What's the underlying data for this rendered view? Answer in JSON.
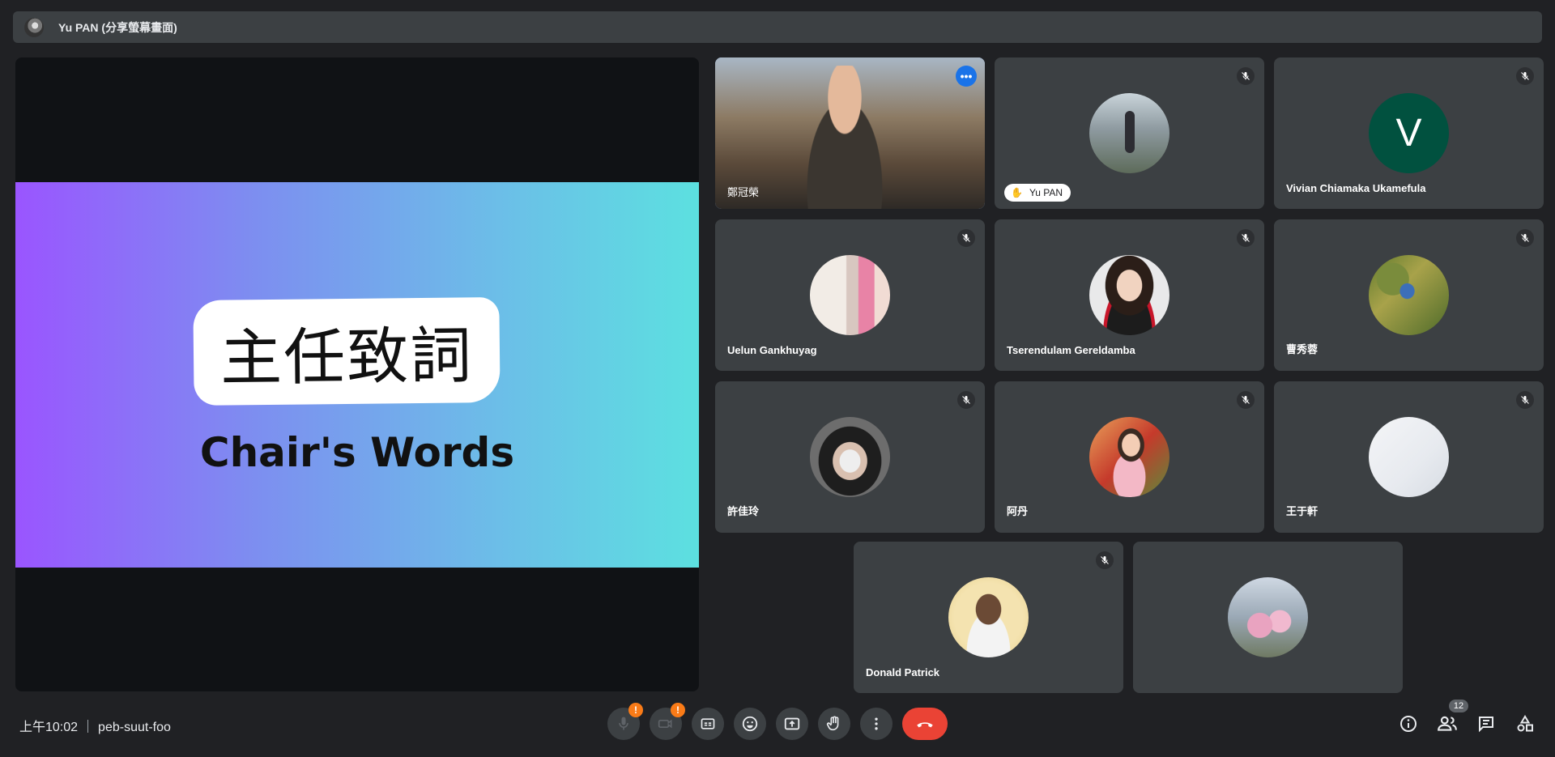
{
  "topbar": {
    "presenter_label": "Yu PAN (分享螢幕畫面)"
  },
  "slide": {
    "title_cn": "主任致詞",
    "title_en": "Chair's Words"
  },
  "tiles": [
    {
      "name": "鄭冠榮",
      "speaking": true
    },
    {
      "name": "Yu PAN",
      "hand_raised": true
    },
    {
      "name": "Vivian Chiamaka Ukamefula",
      "initial": "V",
      "avatar_color": "#01513f"
    },
    {
      "name": "Uelun Gankhuyag"
    },
    {
      "name": "Tserendulam Gereldamba"
    },
    {
      "name": "曹秀蓉"
    },
    {
      "name": "許佳玲"
    },
    {
      "name": "阿丹"
    },
    {
      "name": "王于軒"
    },
    {
      "name": "Donald Patrick"
    },
    {
      "name": ""
    }
  ],
  "bottombar": {
    "time": "上午10:02",
    "meeting_code": "peb-suut-foo",
    "participants_count": "12",
    "warn_mark": "!"
  },
  "icons": {
    "mic": "mic-off-icon",
    "camera": "camera-off-icon",
    "captions": "captions-icon",
    "emoji": "emoji-icon",
    "present": "present-screen-icon",
    "hand": "raise-hand-icon",
    "more": "more-vertical-icon",
    "hangup": "hang-up-icon",
    "info": "info-icon",
    "people": "people-icon",
    "chat": "chat-icon",
    "activities": "activities-icon"
  },
  "colors": {
    "accent": "#1a73e8",
    "hangup": "#ea4335",
    "warning": "#fa7b17",
    "tile": "#3c4043",
    "bg": "#202124"
  }
}
